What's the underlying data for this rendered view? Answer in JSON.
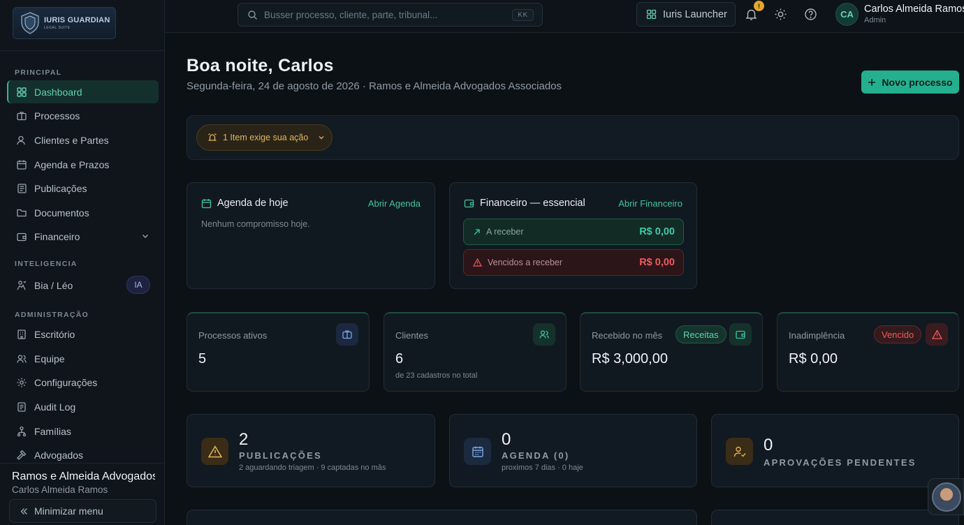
{
  "brand": {
    "name": "IURIS GUARDIAN",
    "tagline": "LEGAL SUITE"
  },
  "sidebar": {
    "sections": [
      {
        "label": "PRINCIPAL"
      },
      {
        "label": "INTELIGENCIA"
      },
      {
        "label": "ADMINISTRAÇÃO"
      }
    ],
    "items": [
      {
        "label": "Dashboard",
        "icon": "grid-icon",
        "active": true
      },
      {
        "label": "Processos",
        "icon": "briefcase-icon"
      },
      {
        "label": "Clientes e Partes",
        "icon": "user-icon"
      },
      {
        "label": "Agenda e Prazos",
        "icon": "calendar-icon"
      },
      {
        "label": "Publicações",
        "icon": "newspaper-icon"
      },
      {
        "label": "Documentos",
        "icon": "folder-icon"
      },
      {
        "label": "Financeiro",
        "icon": "wallet-icon",
        "expandable": true
      },
      {
        "label": "Bia / Léo",
        "icon": "robot-icon",
        "badge": "IA"
      },
      {
        "label": "Escritório",
        "icon": "building-icon"
      },
      {
        "label": "Equipe",
        "icon": "users-icon"
      },
      {
        "label": "Configurações",
        "icon": "gear-icon"
      },
      {
        "label": "Audit Log",
        "icon": "log-icon"
      },
      {
        "label": "Famílias",
        "icon": "family-icon"
      },
      {
        "label": "Advogados",
        "icon": "gavel-icon"
      }
    ],
    "org_name": "Ramos e Almeida Advogados Associados",
    "org_user": "Carlos Almeida Ramos",
    "minimize_label": "Minimizar menu"
  },
  "topbar": {
    "search_placeholder": "Busser processo, cliente, parte, tribunal...",
    "search_shortcut": "KK",
    "launcher_label": "Iuris Launcher",
    "notification_count": "!",
    "user_initials": "CA",
    "user_name": "Carlos Almeida Ramos",
    "user_role": "Admin"
  },
  "header": {
    "greeting": "Boa noite, Carlos",
    "subtitle": "Segunda-feira, 24 de agosto de 2026 · Ramos e Almeida Advogados Associados",
    "new_button": "Novo processo"
  },
  "alerts": {
    "pill_label": "1 Item exige sua ação"
  },
  "agenda_card": {
    "title": "Agenda de hoje",
    "link": "Abrir Agenda",
    "empty": "Nenhum compromisso hoje."
  },
  "finance_card": {
    "title": "Financeiro — essencial",
    "link": "Abrir Financeiro",
    "receivable_label": "A receber",
    "receivable_value": "R$ 0,00",
    "overdue_label": "Vencidos a receber",
    "overdue_value": "R$ 0,00"
  },
  "stats": [
    {
      "label": "Processos ativos",
      "value": "5",
      "sub": ""
    },
    {
      "label": "Clientes",
      "value": "6",
      "sub": "de 23 cadastros no total"
    },
    {
      "label": "Recebido no mês",
      "value": "R$ 3,000,00",
      "chip": "Receitas"
    },
    {
      "label": "Inadimplência",
      "value": "R$ 0,00",
      "chip": "Vencido"
    }
  ],
  "summaries": [
    {
      "count": "2",
      "label": "PUBLICAÇÕES",
      "sub": "2 aguardando triagem · 9 captadas no mâs"
    },
    {
      "count": "0",
      "label": "AGENDA (0)",
      "sub": "proximos 7 dias · 0 haje"
    },
    {
      "count": "0",
      "label": "APROVAÇÕES PENDENTES",
      "sub": ""
    }
  ],
  "colors": {
    "accent": "#24b08f",
    "danger": "#ee5b5f",
    "warning": "#e2b55c",
    "background": "#0c1116"
  }
}
